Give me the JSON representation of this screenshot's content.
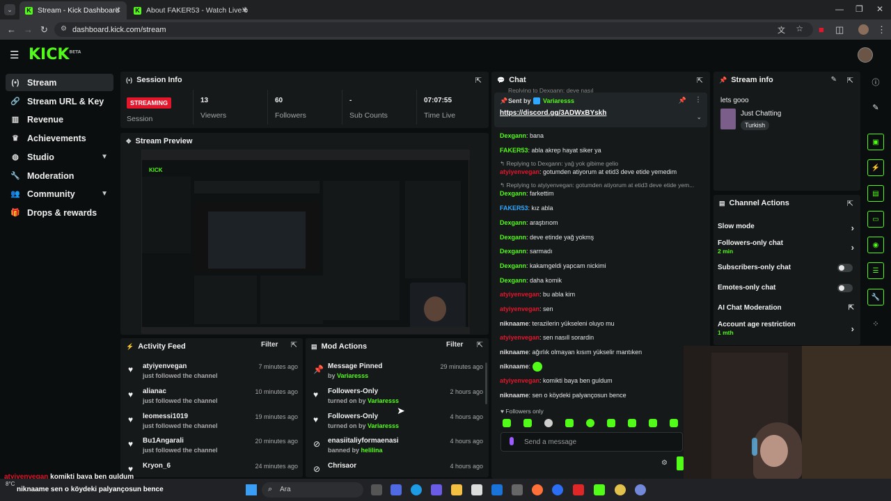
{
  "browser": {
    "tabs": [
      {
        "title": "Stream - Kick Dashboard"
      },
      {
        "title": "About FAKER53 - Watch Live o"
      }
    ],
    "url": "dashboard.kick.com/stream"
  },
  "app": {
    "logo": "KICK",
    "logo_badge": "BETA"
  },
  "sidebar": {
    "items": [
      {
        "label": "Stream",
        "icon": "broadcast-icon"
      },
      {
        "label": "Stream URL & Key",
        "icon": "link-icon"
      },
      {
        "label": "Revenue",
        "icon": "chart-icon"
      },
      {
        "label": "Achievements",
        "icon": "trophy-icon"
      },
      {
        "label": "Studio",
        "icon": "palette-icon"
      },
      {
        "label": "Moderation",
        "icon": "wrench-icon"
      },
      {
        "label": "Community",
        "icon": "users-icon"
      },
      {
        "label": "Drops & rewards",
        "icon": "gift-icon"
      }
    ]
  },
  "session": {
    "title": "Session Info",
    "status_badge": "STREAMING",
    "status_label": "Session",
    "stats": [
      {
        "value": "13",
        "label": "Viewers"
      },
      {
        "value": "60",
        "label": "Followers"
      },
      {
        "value": "-",
        "label": "Sub Counts"
      },
      {
        "value": "07:07:55",
        "label": "Time Live"
      }
    ]
  },
  "preview": {
    "title": "Stream Preview"
  },
  "activity": {
    "title": "Activity Feed",
    "filter": "Filter",
    "items": [
      {
        "name": "atyiyenvegan",
        "action": "just followed the channel",
        "time": "7 minutes ago"
      },
      {
        "name": "alianac",
        "action": "just followed the channel",
        "time": "10 minutes ago"
      },
      {
        "name": "leomessi1019",
        "action": "just followed the channel",
        "time": "19 minutes ago"
      },
      {
        "name": "Bu1Angarali",
        "action": "just followed the channel",
        "time": "20 minutes ago"
      },
      {
        "name": "Kryon_6",
        "action": "",
        "time": "24 minutes ago"
      }
    ]
  },
  "mod": {
    "title": "Mod Actions",
    "filter": "Filter",
    "items": [
      {
        "name": "Message Pinned",
        "prefix": "by",
        "who": "Variaresss",
        "time": "29 minutes ago"
      },
      {
        "name": "Followers-Only",
        "prefix": "turned on by",
        "who": "Variaresss",
        "time": "2 hours ago"
      },
      {
        "name": "Followers-Only",
        "prefix": "turned on by",
        "who": "Variaresss",
        "time": "4 hours ago"
      },
      {
        "name": "enasiitaliyformaenasi",
        "prefix": "banned by",
        "who": "helilina",
        "time": "4 hours ago"
      },
      {
        "name": "Chrisaor",
        "prefix": "",
        "who": "",
        "time": "4 hours ago"
      }
    ]
  },
  "chat": {
    "title": "Chat",
    "pinned_sender_prefix": "Sent by",
    "pinned_sender": "Variaresss",
    "pinned_link": "https://discord.gg/3ADWxBYskh",
    "top_reply": "Replying to Dexgann: deve nasıl",
    "lines": [
      {
        "type": "msg",
        "user": "Dexgann",
        "color": "g",
        "text": "bana"
      },
      {
        "type": "msg",
        "user": "FAKER53",
        "color": "g",
        "text": "abla akrep hayat siker ya"
      },
      {
        "type": "reply",
        "text": "Replying to Dexgann: yağ yok gibime gelio"
      },
      {
        "type": "msg",
        "user": "atyiyenvegan",
        "color": "r",
        "text": "gotumden atiyorum at etid3 deve etide yemedim"
      },
      {
        "type": "reply",
        "text": "Replying to atyiyenvegan: gotumden atiyorum at etid3 deve etide yem..."
      },
      {
        "type": "msg",
        "user": "Dexgann",
        "color": "g",
        "text": "farkettim"
      },
      {
        "type": "msg",
        "user": "FAKER53",
        "color": "b",
        "text": "kız abla"
      },
      {
        "type": "msg",
        "user": "Dexgann",
        "color": "g",
        "text": "araştırıom"
      },
      {
        "type": "msg",
        "user": "Dexgann",
        "color": "g",
        "text": "deve etinde yağ yokmş"
      },
      {
        "type": "msg",
        "user": "Dexgann",
        "color": "g",
        "text": "sarmadı"
      },
      {
        "type": "msg",
        "user": "Dexgann",
        "color": "g",
        "text": "kakamgeldi yapcam nickimi"
      },
      {
        "type": "msg",
        "user": "Dexgann",
        "color": "g",
        "text": "daha komik"
      },
      {
        "type": "msg",
        "user": "atyiyenvegan",
        "color": "r",
        "text": "bu abla kim"
      },
      {
        "type": "msg",
        "user": "atyiyenvegan",
        "color": "r",
        "text": "sen"
      },
      {
        "type": "msg",
        "user": "niknaame",
        "color": "w",
        "text": "terazilerin yükseleni oluyo mu"
      },
      {
        "type": "msg",
        "user": "atyiyenvegan",
        "color": "r",
        "text": "sen nasıll sorardin"
      },
      {
        "type": "msg",
        "user": "niknaame",
        "color": "w",
        "text": "ağırlık olmayan kısım yükselir mantıken"
      },
      {
        "type": "msg",
        "user": "niknaame",
        "color": "w",
        "text": ""
      },
      {
        "type": "msg",
        "user": "atyiyenvegan",
        "color": "r",
        "text": "komikti baya ben guldum"
      },
      {
        "type": "msg",
        "user": "niknaame",
        "color": "w",
        "text": "sen o köydeki palyançosun bence"
      }
    ],
    "followers_only": "Followers only",
    "input_placeholder": "Send a message"
  },
  "stream_info": {
    "title": "Stream info",
    "stream_title": "lets gooo",
    "category": "Just Chatting",
    "tag": "Turkish"
  },
  "channel_actions": {
    "title": "Channel Actions",
    "items": [
      {
        "label": "Slow mode",
        "sub": "",
        "control": "arrow"
      },
      {
        "label": "Followers-only chat",
        "sub": "2 min",
        "control": "arrow"
      },
      {
        "label": "Subscribers-only chat",
        "sub": "",
        "control": "toggle"
      },
      {
        "label": "Emotes-only chat",
        "sub": "",
        "control": "toggle"
      },
      {
        "label": "AI Chat Moderation",
        "sub": "",
        "control": "link"
      },
      {
        "label": "Account age restriction",
        "sub": "1 mth",
        "control": "arrow"
      }
    ]
  },
  "overlay": {
    "line1_user": "atyiyenvegan",
    "line1_text": "komikti baya ben guldum",
    "line2_user": "niknaame",
    "line2_text": "sen o köydeki palyançosun bence",
    "weather": "8°C"
  },
  "taskbar": {
    "search_placeholder": "Ara"
  },
  "colors": {
    "accent": "#53fc18",
    "streaming": "#e3162c",
    "panel": "#15191a",
    "bg": "#0b0e0f"
  }
}
